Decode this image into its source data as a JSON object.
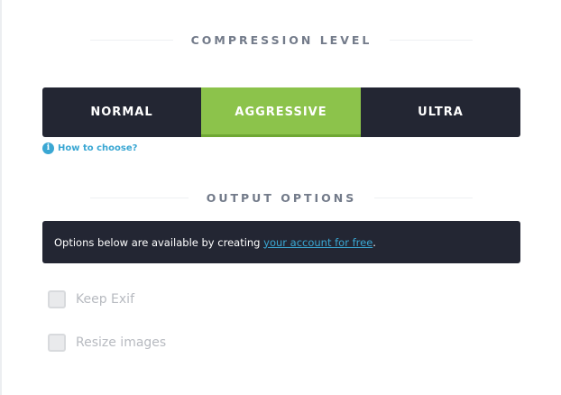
{
  "compression": {
    "heading": "COMPRESSION LEVEL",
    "levels": [
      {
        "label": "NORMAL",
        "active": false
      },
      {
        "label": "AGGRESSIVE",
        "active": true
      },
      {
        "label": "ULTRA",
        "active": false
      }
    ],
    "help_icon": "i",
    "help_link": "How to choose?"
  },
  "output": {
    "heading": "OUTPUT OPTIONS",
    "notice_text": "Options below are available by creating ",
    "notice_link": "your account for free",
    "notice_suffix": ".",
    "options": [
      {
        "label": "Keep Exif",
        "checked": false,
        "disabled": true
      },
      {
        "label": "Resize images",
        "checked": false,
        "disabled": true
      }
    ]
  },
  "colors": {
    "dark_bar": "#232633",
    "active_green": "#8cc34b",
    "link_blue": "#3aa7d3",
    "heading_gray": "#737b8a"
  }
}
